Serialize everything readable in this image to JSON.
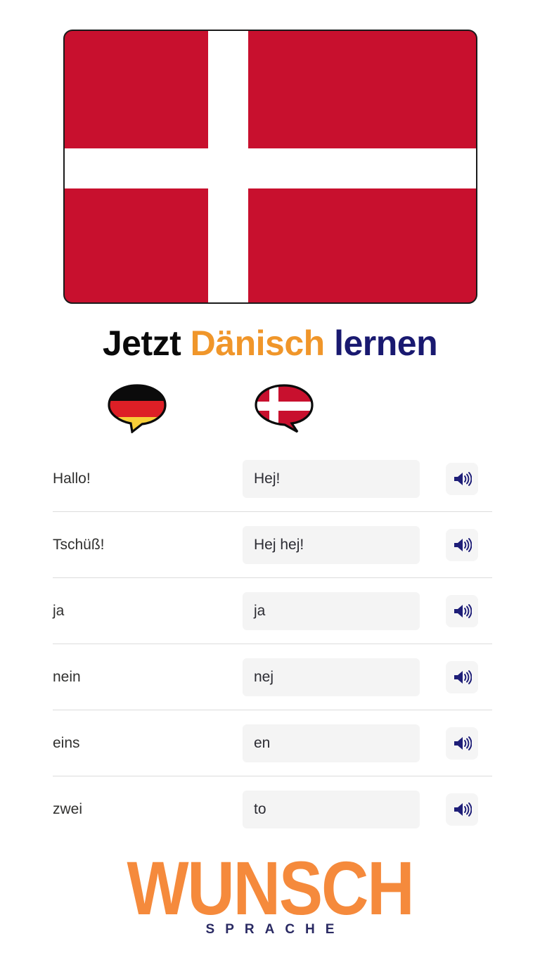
{
  "flag": {
    "name": "denmark-flag",
    "red": "#C8102E",
    "white": "#FFFFFF",
    "border": "#1B1B1B"
  },
  "title": {
    "part1": "Jetzt",
    "part2": "Dänisch",
    "part3": "lernen",
    "color1": "#0A0A0A",
    "color2": "#F0962A",
    "color3": "#191970"
  },
  "columns": {
    "source_flag": "german-flag-speech-bubble",
    "target_flag": "danish-flag-speech-bubble"
  },
  "rows": [
    {
      "source": "Hallo!",
      "target": "Hej!",
      "audio": "speaker-icon"
    },
    {
      "source": "Tschüß!",
      "target": "Hej hej!",
      "audio": "speaker-icon"
    },
    {
      "source": "ja",
      "target": "ja",
      "audio": "speaker-icon"
    },
    {
      "source": "nein",
      "target": "nej",
      "audio": "speaker-icon"
    },
    {
      "source": "eins",
      "target": "en",
      "audio": "speaker-icon"
    },
    {
      "source": "zwei",
      "target": "to",
      "audio": "speaker-icon"
    }
  ],
  "logo": {
    "main": "WUNSCH",
    "sub": "SPRACHE",
    "main_color": "#F58A3C",
    "sub_color": "#2A2A63"
  }
}
